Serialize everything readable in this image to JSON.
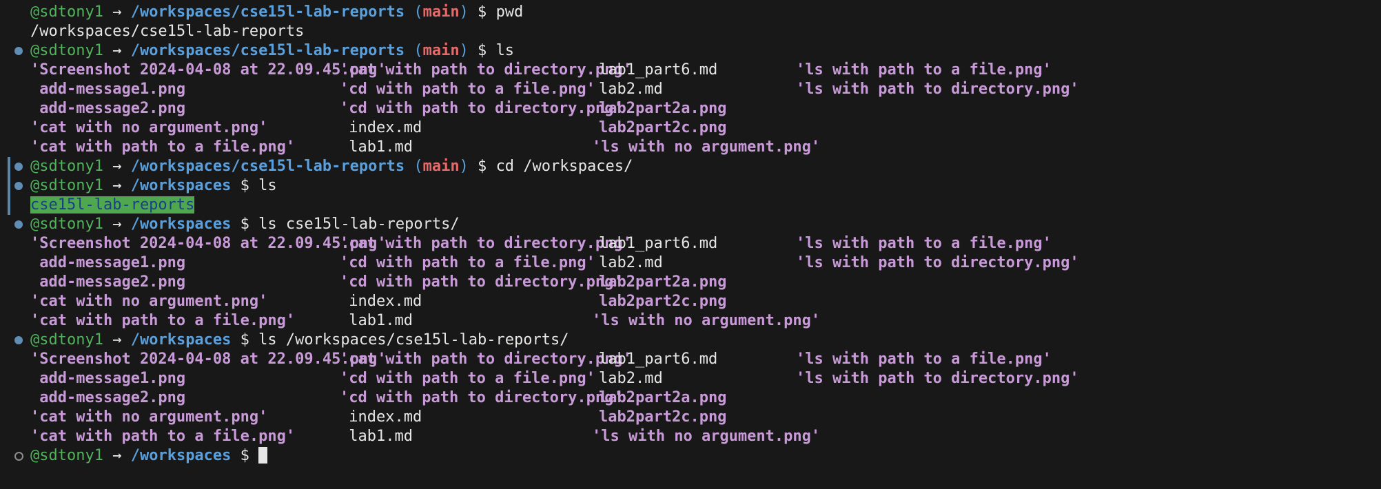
{
  "prompt": {
    "user": "@sdtony1",
    "arrow": "→",
    "branch": "main",
    "dollar": "$"
  },
  "lines": [
    {
      "type": "prompt",
      "marker": "none",
      "path": "/workspaces/cse15l-lab-reports",
      "branch": true,
      "cmd": "pwd"
    },
    {
      "type": "text",
      "marker": "none",
      "text": "/workspaces/cse15l-lab-reports"
    },
    {
      "type": "prompt",
      "marker": "dot",
      "path": "/workspaces/cse15l-lab-reports",
      "branch": true,
      "cmd": "ls"
    },
    {
      "type": "ls",
      "marker": "none",
      "cells": [
        {
          "text": "'Screenshot 2024-04-08 at 22.09.45.png'",
          "kind": "img",
          "col": 0
        },
        {
          "text": "'cat with path to directory.png'",
          "kind": "img",
          "col": 1
        },
        {
          "text": "lab1_part6.md",
          "kind": "md",
          "col": 2
        },
        {
          "text": "'ls with path to a file.png'",
          "kind": "img",
          "col": 3
        }
      ]
    },
    {
      "type": "ls",
      "marker": "none",
      "cells": [
        {
          "text": " add-message1.png",
          "kind": "img",
          "col": 0
        },
        {
          "text": "'cd with path to a file.png'",
          "kind": "img",
          "col": 1
        },
        {
          "text": "lab2.md",
          "kind": "md",
          "col": 2
        },
        {
          "text": "'ls with path to directory.png'",
          "kind": "img",
          "col": 3
        }
      ]
    },
    {
      "type": "ls",
      "marker": "none",
      "cells": [
        {
          "text": " add-message2.png",
          "kind": "img",
          "col": 0
        },
        {
          "text": "'cd with path to directory.png'",
          "kind": "img",
          "col": 1
        },
        {
          "text": "lab2part2a.png",
          "kind": "img",
          "col": 2
        }
      ]
    },
    {
      "type": "ls",
      "marker": "none",
      "cells": [
        {
          "text": "'cat with no argument.png'",
          "kind": "img",
          "col": 0
        },
        {
          "text": " index.md",
          "kind": "md",
          "col": 1
        },
        {
          "text": "lab2part2c.png",
          "kind": "img",
          "col": 2
        }
      ]
    },
    {
      "type": "ls",
      "marker": "none",
      "cells": [
        {
          "text": "'cat with path to a file.png'",
          "kind": "img",
          "col": 0
        },
        {
          "text": " lab1.md",
          "kind": "md",
          "col": 1
        },
        {
          "text": "'ls with no argument.png'",
          "kind": "img",
          "col": 2,
          "shift": true
        }
      ]
    },
    {
      "type": "prompt",
      "marker": "bar-dot",
      "path": "/workspaces/cse15l-lab-reports",
      "branch": true,
      "cmd": "cd /workspaces/"
    },
    {
      "type": "prompt",
      "marker": "bar-dot",
      "path": "/workspaces",
      "branch": false,
      "cmd": "ls"
    },
    {
      "type": "dir",
      "marker": "bar",
      "text": "cse15l-lab-reports"
    },
    {
      "type": "prompt",
      "marker": "dot",
      "path": "/workspaces",
      "branch": false,
      "cmd": "ls cse15l-lab-reports/"
    },
    {
      "type": "ls",
      "marker": "none",
      "cells": [
        {
          "text": "'Screenshot 2024-04-08 at 22.09.45.png'",
          "kind": "img",
          "col": 0
        },
        {
          "text": "'cat with path to directory.png'",
          "kind": "img",
          "col": 1
        },
        {
          "text": "lab1_part6.md",
          "kind": "md",
          "col": 2
        },
        {
          "text": "'ls with path to a file.png'",
          "kind": "img",
          "col": 3
        }
      ]
    },
    {
      "type": "ls",
      "marker": "none",
      "cells": [
        {
          "text": " add-message1.png",
          "kind": "img",
          "col": 0
        },
        {
          "text": "'cd with path to a file.png'",
          "kind": "img",
          "col": 1
        },
        {
          "text": "lab2.md",
          "kind": "md",
          "col": 2
        },
        {
          "text": "'ls with path to directory.png'",
          "kind": "img",
          "col": 3
        }
      ]
    },
    {
      "type": "ls",
      "marker": "none",
      "cells": [
        {
          "text": " add-message2.png",
          "kind": "img",
          "col": 0
        },
        {
          "text": "'cd with path to directory.png'",
          "kind": "img",
          "col": 1
        },
        {
          "text": "lab2part2a.png",
          "kind": "img",
          "col": 2
        }
      ]
    },
    {
      "type": "ls",
      "marker": "none",
      "cells": [
        {
          "text": "'cat with no argument.png'",
          "kind": "img",
          "col": 0
        },
        {
          "text": " index.md",
          "kind": "md",
          "col": 1
        },
        {
          "text": "lab2part2c.png",
          "kind": "img",
          "col": 2
        }
      ]
    },
    {
      "type": "ls",
      "marker": "none",
      "cells": [
        {
          "text": "'cat with path to a file.png'",
          "kind": "img",
          "col": 0
        },
        {
          "text": " lab1.md",
          "kind": "md",
          "col": 1
        },
        {
          "text": "'ls with no argument.png'",
          "kind": "img",
          "col": 2,
          "shift": true
        }
      ]
    },
    {
      "type": "prompt",
      "marker": "dot",
      "path": "/workspaces",
      "branch": false,
      "cmd": "ls /workspaces/cse15l-lab-reports/"
    },
    {
      "type": "ls",
      "marker": "none",
      "cells": [
        {
          "text": "'Screenshot 2024-04-08 at 22.09.45.png'",
          "kind": "img",
          "col": 0
        },
        {
          "text": "'cat with path to directory.png'",
          "kind": "img",
          "col": 1
        },
        {
          "text": "lab1_part6.md",
          "kind": "md",
          "col": 2
        },
        {
          "text": "'ls with path to a file.png'",
          "kind": "img",
          "col": 3
        }
      ]
    },
    {
      "type": "ls",
      "marker": "none",
      "cells": [
        {
          "text": " add-message1.png",
          "kind": "img",
          "col": 0
        },
        {
          "text": "'cd with path to a file.png'",
          "kind": "img",
          "col": 1
        },
        {
          "text": "lab2.md",
          "kind": "md",
          "col": 2
        },
        {
          "text": "'ls with path to directory.png'",
          "kind": "img",
          "col": 3
        }
      ]
    },
    {
      "type": "ls",
      "marker": "none",
      "cells": [
        {
          "text": " add-message2.png",
          "kind": "img",
          "col": 0
        },
        {
          "text": "'cd with path to directory.png'",
          "kind": "img",
          "col": 1
        },
        {
          "text": "lab2part2a.png",
          "kind": "img",
          "col": 2
        }
      ]
    },
    {
      "type": "ls",
      "marker": "none",
      "cells": [
        {
          "text": "'cat with no argument.png'",
          "kind": "img",
          "col": 0
        },
        {
          "text": " index.md",
          "kind": "md",
          "col": 1
        },
        {
          "text": "lab2part2c.png",
          "kind": "img",
          "col": 2
        }
      ]
    },
    {
      "type": "ls",
      "marker": "none",
      "cells": [
        {
          "text": "'cat with path to a file.png'",
          "kind": "img",
          "col": 0
        },
        {
          "text": " lab1.md",
          "kind": "md",
          "col": 1
        },
        {
          "text": "'ls with no argument.png'",
          "kind": "img",
          "col": 2,
          "shift": true
        }
      ]
    },
    {
      "type": "prompt",
      "marker": "hollow",
      "path": "/workspaces",
      "branch": false,
      "cmd": "",
      "cursor": true
    }
  ]
}
